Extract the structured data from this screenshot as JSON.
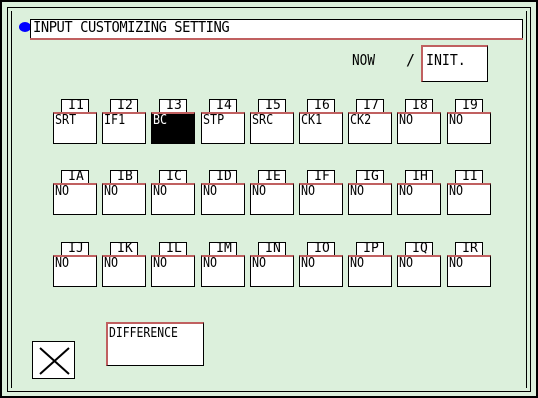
{
  "header": {
    "title": "INPUT CUSTOMIZING SETTING"
  },
  "status": {
    "now_label": "NOW",
    "separator": "/",
    "init_label": "INIT."
  },
  "grid": {
    "rows": [
      [
        {
          "id": "I1",
          "value": "SRT"
        },
        {
          "id": "I2",
          "value": "IF1"
        },
        {
          "id": "I3",
          "value": "BC",
          "selected": true
        },
        {
          "id": "I4",
          "value": "STP"
        },
        {
          "id": "I5",
          "value": "SRC"
        },
        {
          "id": "I6",
          "value": "CK1"
        },
        {
          "id": "I7",
          "value": "CK2"
        },
        {
          "id": "I8",
          "value": "NO"
        },
        {
          "id": "I9",
          "value": "NO"
        }
      ],
      [
        {
          "id": "IA",
          "value": "NO"
        },
        {
          "id": "IB",
          "value": "NO"
        },
        {
          "id": "IC",
          "value": "NO"
        },
        {
          "id": "ID",
          "value": "NO"
        },
        {
          "id": "IE",
          "value": "NO"
        },
        {
          "id": "IF",
          "value": "NO"
        },
        {
          "id": "IG",
          "value": "NO"
        },
        {
          "id": "IH",
          "value": "NO"
        },
        {
          "id": "II",
          "value": "NO"
        }
      ],
      [
        {
          "id": "IJ",
          "value": "NO"
        },
        {
          "id": "IK",
          "value": "NO"
        },
        {
          "id": "IL",
          "value": "NO"
        },
        {
          "id": "IM",
          "value": "NO"
        },
        {
          "id": "IN",
          "value": "NO"
        },
        {
          "id": "IO",
          "value": "NO"
        },
        {
          "id": "IP",
          "value": "NO"
        },
        {
          "id": "IQ",
          "value": "NO"
        },
        {
          "id": "IR",
          "value": "NO"
        }
      ]
    ]
  },
  "footer": {
    "difference_label": "DIFFERENCE",
    "close_icon": "close-x-icon"
  },
  "colors": {
    "background": "#dcf0dc",
    "accent_border": "#c06060",
    "title_dot": "#0000ff"
  }
}
